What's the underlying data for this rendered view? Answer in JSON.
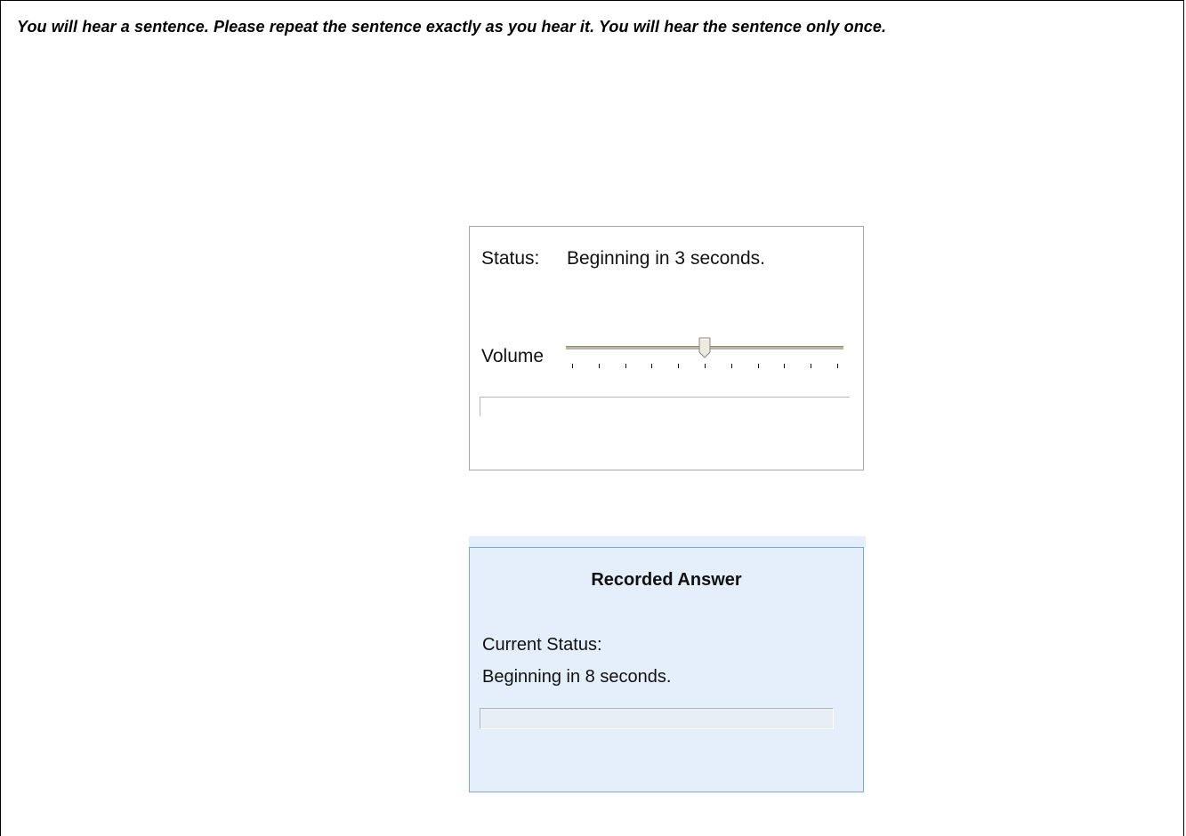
{
  "instructions": "You will hear a sentence. Please repeat the sentence exactly as you hear it. You will hear the sentence only once.",
  "player": {
    "status_label": "Status:",
    "status_text": "Beginning in 3 seconds.",
    "volume_label": "Volume",
    "volume_level": 0.5,
    "volume_ticks": 11,
    "progress": 0
  },
  "recorder": {
    "title": "Recorded Answer",
    "status_label": "Current Status:",
    "status_text": "Beginning in 8 seconds.",
    "progress": 0
  },
  "colors": {
    "recorder_background": "#e5eefb",
    "recorder_border": "#7ea7d8"
  }
}
